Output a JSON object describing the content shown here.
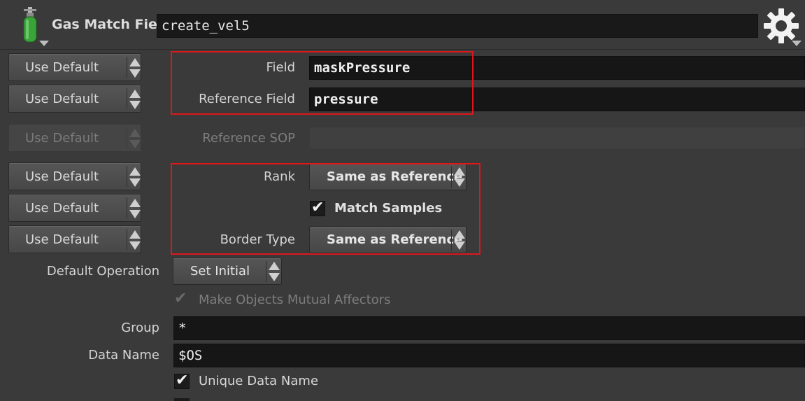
{
  "header": {
    "node_type": "Gas Match Field",
    "node_name": "create_vel5",
    "node_icon": "gas-cylinder-icon",
    "gear_icon": "gear-icon"
  },
  "use_default_label": "Use Default",
  "params": {
    "field": {
      "label": "Field",
      "value": "maskPressure"
    },
    "reference_field": {
      "label": "Reference Field",
      "value": "pressure"
    },
    "reference_sop": {
      "label": "Reference SOP",
      "value": ""
    },
    "rank": {
      "label": "Rank",
      "value": "Same as Reference"
    },
    "match_samples": {
      "label": "Match Samples",
      "checked": true
    },
    "border_type": {
      "label": "Border Type",
      "value": "Same as Reference"
    },
    "default_operation": {
      "label": "Default Operation",
      "value": "Set Initial"
    },
    "mutual_affectors": {
      "label": "Make Objects Mutual Affectors",
      "checked": true,
      "enabled": false
    },
    "group": {
      "label": "Group",
      "value": "*"
    },
    "data_name": {
      "label": "Data Name",
      "value": "$OS"
    },
    "unique_data_name": {
      "label": "Unique Data Name",
      "checked": true
    }
  },
  "colors": {
    "highlight": "#e0161d",
    "background": "#3a3a3a",
    "field_bg": "#161616"
  }
}
